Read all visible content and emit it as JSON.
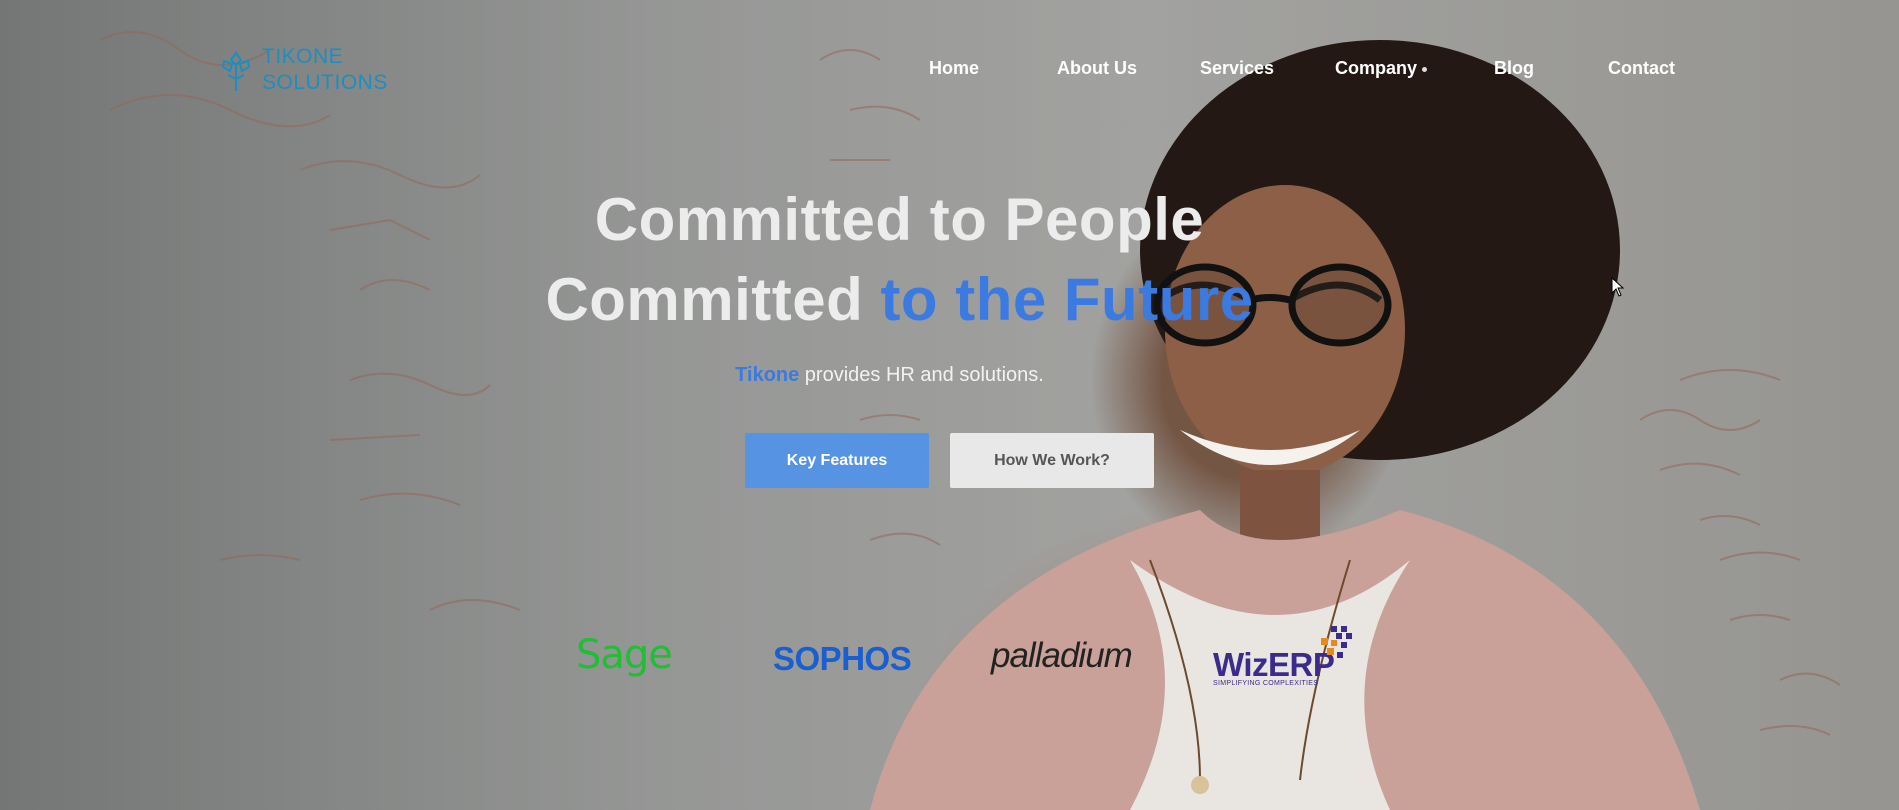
{
  "logo": {
    "line1": "TIKONE",
    "line2": "SOLUTIONS",
    "icon": "tree-leaf-icon",
    "color": "#1b8fc0"
  },
  "nav": {
    "items": [
      {
        "label": "Home"
      },
      {
        "label": "About Us"
      },
      {
        "label": "Services"
      },
      {
        "label": "Company",
        "has_dropdown": true
      },
      {
        "label": "Blog"
      },
      {
        "label": "Contact"
      }
    ]
  },
  "hero": {
    "line1": "Committed to People",
    "line2_a": "Committed ",
    "line2_b": "to the Future",
    "subtitle_brand": "Tikone",
    "subtitle_rest": " provides HR and solutions.",
    "accent_color": "#3b7ae0"
  },
  "buttons": {
    "primary": "Key Features",
    "secondary": "How We Work?"
  },
  "partners": {
    "sage": "Sage",
    "sophos": "SOPHOS",
    "palladium": "palladium",
    "wizerp": "WizERP",
    "wizerp_tagline": "SIMPLIFYING COMPLEXITIES"
  }
}
